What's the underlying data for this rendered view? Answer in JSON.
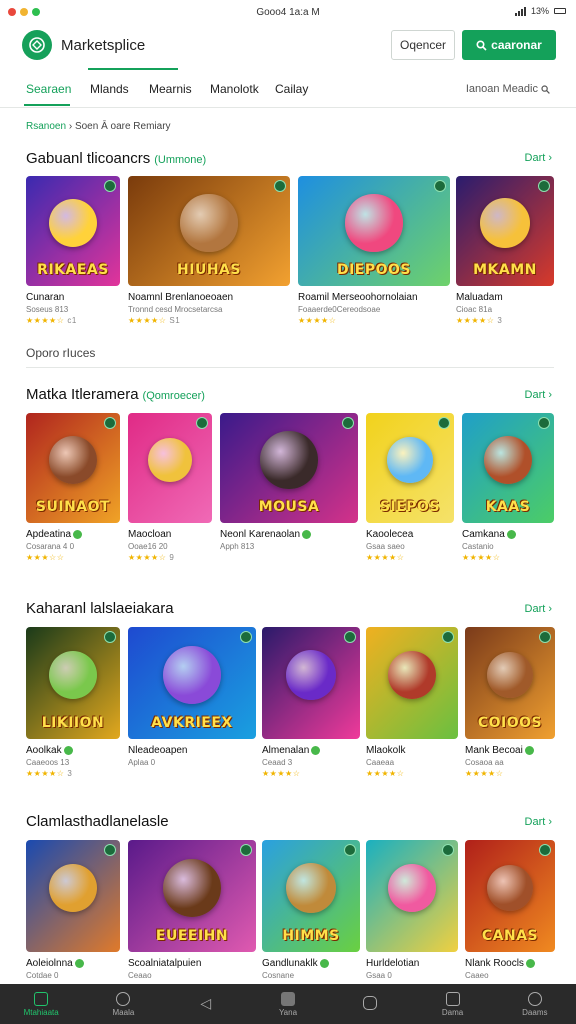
{
  "status_bar": {
    "center": "Gooo4 1a:a M",
    "right": "13%"
  },
  "header": {
    "app_title": "Marketsplice",
    "secondary_button": "Oqencer",
    "primary_button": "caaronar"
  },
  "tabs": {
    "items": [
      {
        "label": "Searaen",
        "active": true
      },
      {
        "label": "Mlands",
        "active": false
      },
      {
        "label": "Mearnis",
        "active": false
      },
      {
        "label": "Manolotk",
        "active": false
      },
      {
        "label": "Cailay",
        "active": false
      }
    ],
    "sort_label": "Ianoan Meadic"
  },
  "breadcrumb": {
    "current": "Rsanoen",
    "rest": "Soen  Ā oare Remiary"
  },
  "divider_label": "Oporo rIuces",
  "sections": [
    {
      "title": "Gabuanl tlicoancrs",
      "subtitle": "(Ummone)",
      "see_all": "Dart",
      "cards": [
        {
          "title": "Cunaran",
          "meta": "Soseus 813",
          "rating": "★★★★☆",
          "count": "c1",
          "banner": "RIKAEAS",
          "bg": [
            "#3a2ab0",
            "#e2349a"
          ],
          "char": "#ffd23a"
        },
        {
          "title": "Noamnl Brenlanoeoaen",
          "meta": "Tronnd cesd Mrocsetarcsa",
          "rating": "★★★★☆",
          "count": "S1",
          "banner": "HIUHAS",
          "bg": [
            "#7a3b0c",
            "#f2a130"
          ],
          "char": "#b2763f"
        },
        {
          "title": "Roamil Merseoohornolaian",
          "meta": "Foaaerde0Cereodsoae",
          "rating": "★★★★☆",
          "count": "",
          "banner": "DIEPOOS",
          "bg": [
            "#1e8fe0",
            "#6fd26a"
          ],
          "char": "#f0487f"
        },
        {
          "title": "Maluadam",
          "meta": "Cioac 81a",
          "rating": "★★★★☆",
          "count": "3",
          "banner": "MKAMN",
          "bg": [
            "#2a1c6e",
            "#d83a2a"
          ],
          "char": "#f6c13a"
        }
      ]
    },
    {
      "title": "Matka Itleramera",
      "subtitle": "(Qomroecer)",
      "see_all": "Dart",
      "cards": [
        {
          "title": "Apdeatina",
          "meta": "Cosarana 4 0",
          "rating": "★★★☆☆",
          "count": "",
          "banner": "SUINAOT",
          "bg": [
            "#b0251e",
            "#f0a326"
          ],
          "char": "#8a4a2a"
        },
        {
          "title": "Maocloan",
          "meta": "Ooae16 20",
          "rating": "★★★★☆",
          "count": "9",
          "banner": "",
          "bg": [
            "#e02a86",
            "#f06ab6"
          ],
          "char": "#f0c23c"
        },
        {
          "title": "Neonl Karenaolan",
          "meta": "Apph 813",
          "rating": "",
          "count": "",
          "banner": "MOUSA",
          "bg": [
            "#3a1a8a",
            "#d4328a"
          ],
          "char": "#3a2a2a"
        },
        {
          "title": "Kaoolecea",
          "meta": "Gsaa saeo",
          "rating": "★★★★☆",
          "count": "",
          "banner": "SIEPOS",
          "bg": [
            "#f2d21c",
            "#f5e26a"
          ],
          "char": "#5fb8f5"
        },
        {
          "title": "Camkana",
          "meta": "Castanio",
          "rating": "★★★★☆",
          "count": "",
          "banner": "KAAS",
          "bg": [
            "#1f9fc8",
            "#4ccd66"
          ],
          "char": "#b0502a"
        }
      ]
    },
    {
      "title": "Kaharanl lalslaeiakara",
      "subtitle": "",
      "see_all": "Dart",
      "cards": [
        {
          "title": "Aoolkak",
          "meta": "Caaeoos 13",
          "rating": "★★★★☆",
          "count": "3",
          "banner": "LIKIION",
          "bg": [
            "#1a3a1a",
            "#e2a81e"
          ],
          "char": "#7ac84c"
        },
        {
          "title": "Nleadeoapen",
          "meta": "Aplaa 0",
          "rating": "",
          "count": "",
          "banner": "AVKRIEEX",
          "bg": [
            "#1e4ad0",
            "#1aa0e0"
          ],
          "char": "#8a4ad8"
        },
        {
          "title": "Almenalan",
          "meta": "Ceaad 3",
          "rating": "★★★★☆",
          "count": "",
          "banner": "",
          "bg": [
            "#2a1a6a",
            "#f03a9a"
          ],
          "char": "#6a2ac8"
        },
        {
          "title": "Mlaokolk",
          "meta": "Caaeaa",
          "rating": "★★★★☆",
          "count": "",
          "banner": "",
          "bg": [
            "#f0b020",
            "#6ac040"
          ],
          "char": "#b03a2a"
        },
        {
          "title": "Mank Becoai",
          "meta": "Cosaoa aa",
          "rating": "★★★★☆",
          "count": "",
          "banner": "COIOOS",
          "bg": [
            "#7a3a1a",
            "#f0a030"
          ],
          "char": "#a05a2a"
        }
      ]
    },
    {
      "title": "Clamlasthadlanelasle",
      "subtitle": "",
      "see_all": "Dart",
      "cards": [
        {
          "title": "Aoleiolnna",
          "meta": "Cotdae 0",
          "rating": "",
          "count": "",
          "banner": "",
          "bg": [
            "#1a4ab0",
            "#e07a2a"
          ],
          "char": "#e0a030"
        },
        {
          "title": "Scoalniatalpuien",
          "meta": "Ceaao",
          "rating": "",
          "count": "",
          "banner": "EUEEIHN",
          "bg": [
            "#5a1a8a",
            "#e05ab0"
          ],
          "char": "#6a3a1a"
        },
        {
          "title": "Gandlunaklk",
          "meta": "Cosnane",
          "rating": "",
          "count": "",
          "banner": "HIMMS",
          "bg": [
            "#2aa0e0",
            "#6ad040"
          ],
          "char": "#c08a3a"
        },
        {
          "title": "Hurldelotian",
          "meta": "Gsaa 0",
          "rating": "",
          "count": "",
          "banner": "",
          "bg": [
            "#1ab0c0",
            "#f0d040"
          ],
          "char": "#f05aa0"
        },
        {
          "title": "Nlank Roocls",
          "meta": "Caaeo",
          "rating": "",
          "count": "",
          "banner": "CANAS",
          "bg": [
            "#b0201a",
            "#f08a20"
          ],
          "char": "#a0502a"
        }
      ]
    }
  ],
  "bottom_nav": [
    {
      "label": "Mtahiaata",
      "icon": "home-icon",
      "active": true
    },
    {
      "label": "Maala",
      "icon": "search-icon",
      "active": false
    },
    {
      "label": "",
      "icon": "back-icon",
      "active": false
    },
    {
      "label": "Yana",
      "icon": "library-icon",
      "active": false
    },
    {
      "label": "",
      "icon": "chat-icon",
      "active": false
    },
    {
      "label": "Dama",
      "icon": "store-icon",
      "active": false
    },
    {
      "label": "Daams",
      "icon": "profile-icon",
      "active": false
    }
  ],
  "colors": {
    "accent": "#14a15a",
    "nav_bg": "#2a2a2a"
  }
}
